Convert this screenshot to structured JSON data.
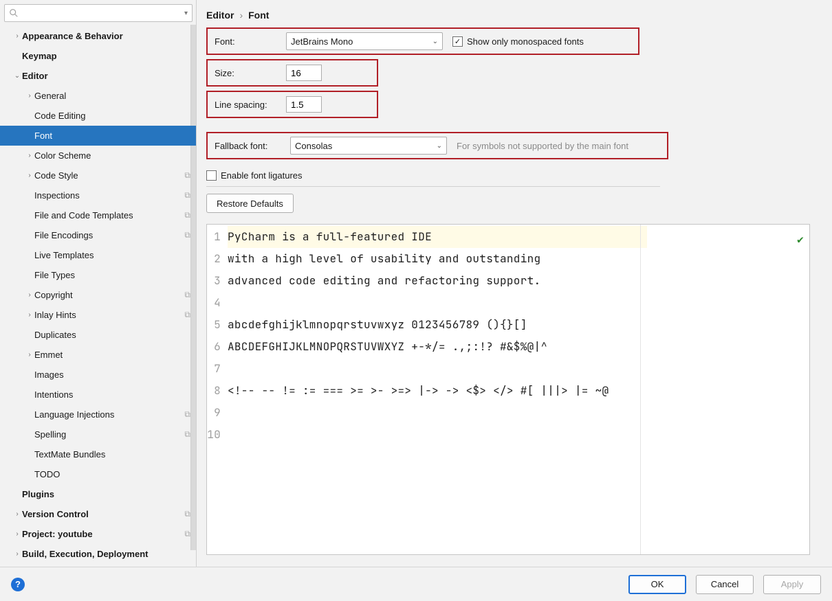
{
  "search": {
    "placeholder": ""
  },
  "sidebar": {
    "items": [
      {
        "label": "Appearance & Behavior",
        "depth": 1,
        "bold": true,
        "expandable": true,
        "expanded": false
      },
      {
        "label": "Keymap",
        "depth": 1,
        "bold": true
      },
      {
        "label": "Editor",
        "depth": 1,
        "bold": true,
        "expandable": true,
        "expanded": true
      },
      {
        "label": "General",
        "depth": 2,
        "expandable": true,
        "expanded": false
      },
      {
        "label": "Code Editing",
        "depth": 2
      },
      {
        "label": "Font",
        "depth": 2,
        "selected": true
      },
      {
        "label": "Color Scheme",
        "depth": 2,
        "expandable": true,
        "expanded": false
      },
      {
        "label": "Code Style",
        "depth": 2,
        "expandable": true,
        "expanded": false,
        "copy": true
      },
      {
        "label": "Inspections",
        "depth": 2,
        "copy": true
      },
      {
        "label": "File and Code Templates",
        "depth": 2,
        "copy": true
      },
      {
        "label": "File Encodings",
        "depth": 2,
        "copy": true
      },
      {
        "label": "Live Templates",
        "depth": 2
      },
      {
        "label": "File Types",
        "depth": 2
      },
      {
        "label": "Copyright",
        "depth": 2,
        "expandable": true,
        "expanded": false,
        "copy": true
      },
      {
        "label": "Inlay Hints",
        "depth": 2,
        "expandable": true,
        "expanded": false,
        "copy": true
      },
      {
        "label": "Duplicates",
        "depth": 2
      },
      {
        "label": "Emmet",
        "depth": 2,
        "expandable": true,
        "expanded": false
      },
      {
        "label": "Images",
        "depth": 2
      },
      {
        "label": "Intentions",
        "depth": 2
      },
      {
        "label": "Language Injections",
        "depth": 2,
        "copy": true
      },
      {
        "label": "Spelling",
        "depth": 2,
        "copy": true
      },
      {
        "label": "TextMate Bundles",
        "depth": 2
      },
      {
        "label": "TODO",
        "depth": 2
      },
      {
        "label": "Plugins",
        "depth": 1,
        "bold": true
      },
      {
        "label": "Version Control",
        "depth": 1,
        "bold": true,
        "expandable": true,
        "expanded": false,
        "copy": true
      },
      {
        "label": "Project: youtube",
        "depth": 1,
        "bold": true,
        "expandable": true,
        "expanded": false,
        "copy": true
      },
      {
        "label": "Build, Execution, Deployment",
        "depth": 1,
        "bold": true,
        "expandable": true,
        "expanded": false
      }
    ]
  },
  "breadcrumb": {
    "parent": "Editor",
    "current": "Font"
  },
  "font": {
    "font_label": "Font:",
    "font_value": "JetBrains Mono",
    "show_mono_label": "Show only monospaced fonts",
    "show_mono_checked": true,
    "size_label": "Size:",
    "size_value": "16",
    "spacing_label": "Line spacing:",
    "spacing_value": "1.5",
    "fallback_label": "Fallback font:",
    "fallback_value": "Consolas",
    "fallback_hint": "For symbols not supported by the main font",
    "ligatures_label": "Enable font ligatures",
    "ligatures_checked": false,
    "restore_label": "Restore Defaults"
  },
  "preview": {
    "lines": [
      "PyCharm is a full-featured IDE",
      "with a high level of usability and outstanding",
      "advanced code editing and refactoring support.",
      "",
      "abcdefghijklmnopqrstuvwxyz 0123456789 (){}[]",
      "ABCDEFGHIJKLMNOPQRSTUVWXYZ +-*/= .,;:!? #&$%@|^",
      "",
      "<!-- -- != := === >= >- >=> |-> -> <$> </> #[ |||> |= ~@",
      "",
      ""
    ]
  },
  "footer": {
    "ok": "OK",
    "cancel": "Cancel",
    "apply": "Apply"
  }
}
